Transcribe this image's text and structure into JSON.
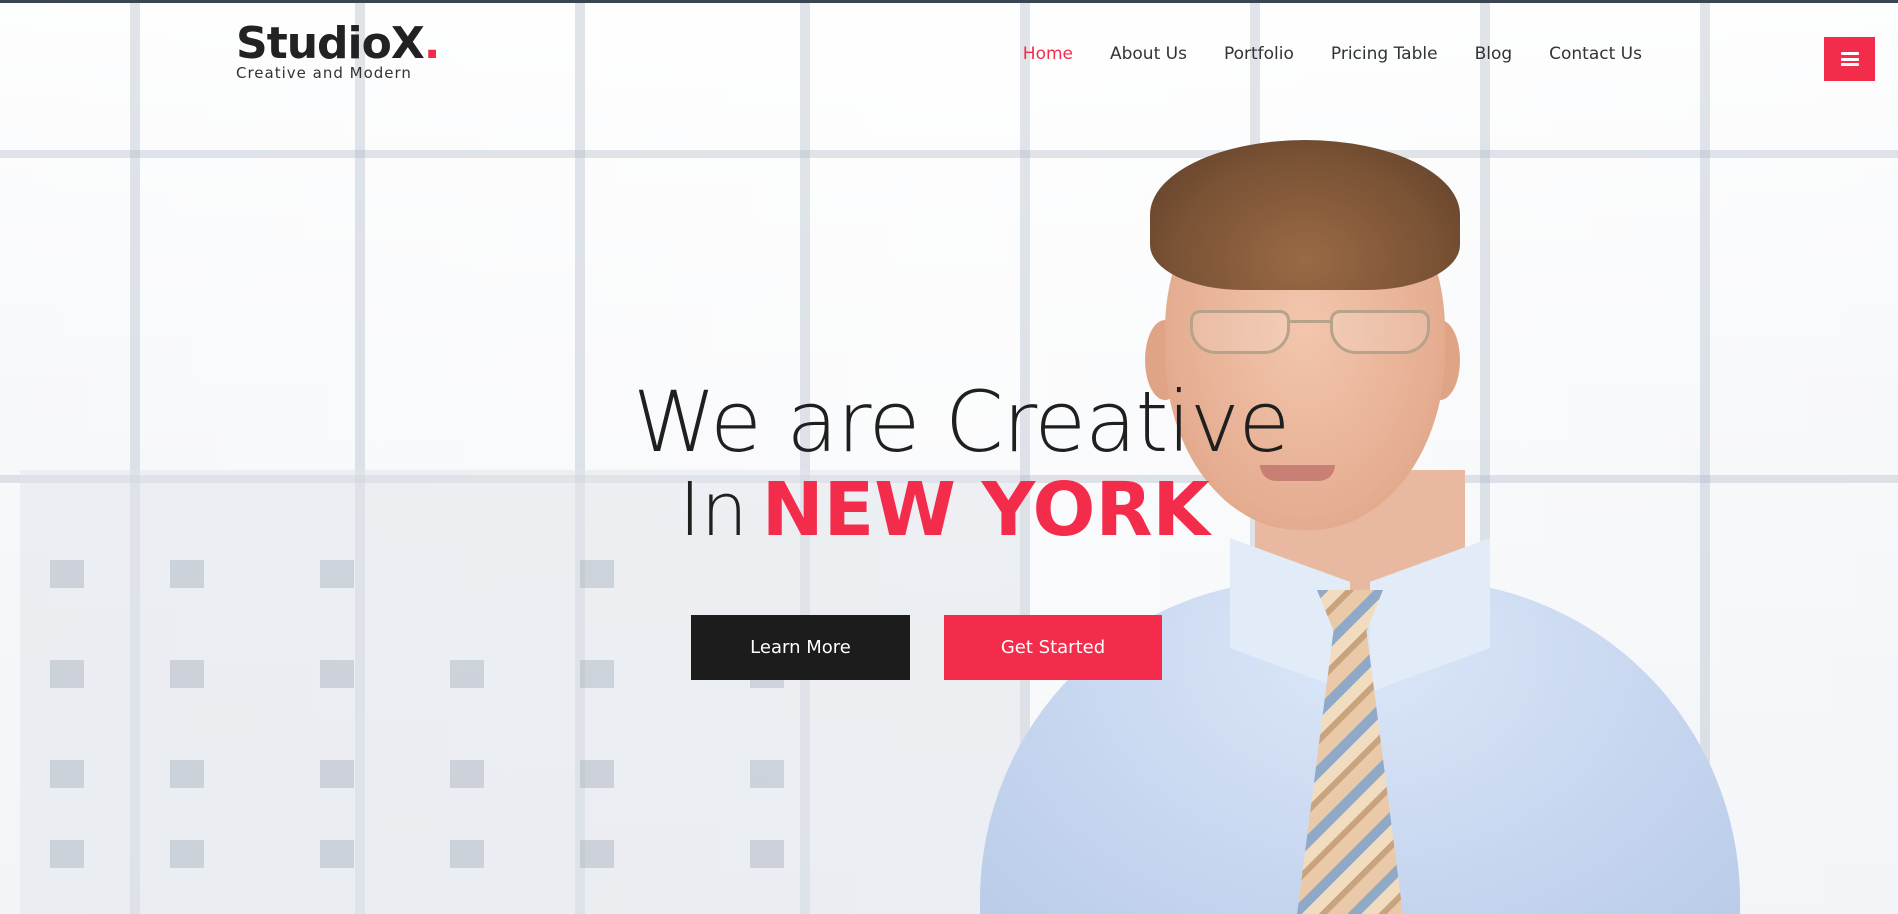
{
  "brand": {
    "name": "Studio",
    "name_accent": "X",
    "dot": ".",
    "tagline": "Creative and Modern",
    "accent_color": "#f42c4c"
  },
  "nav": {
    "items": [
      {
        "label": "Home",
        "active": true
      },
      {
        "label": "About Us",
        "active": false
      },
      {
        "label": "Portfolio",
        "active": false
      },
      {
        "label": "Pricing Table",
        "active": false
      },
      {
        "label": "Blog",
        "active": false
      },
      {
        "label": "Contact Us",
        "active": false
      }
    ],
    "menu_icon": "hamburger-icon"
  },
  "hero": {
    "line1": "We are Creative",
    "line2_prefix": "In",
    "line2_accent": "NEW YORK",
    "buttons": {
      "primary": "Learn More",
      "secondary": "Get Started"
    }
  },
  "colors": {
    "dark_button": "#1c1c1c",
    "accent": "#f42c4c"
  }
}
